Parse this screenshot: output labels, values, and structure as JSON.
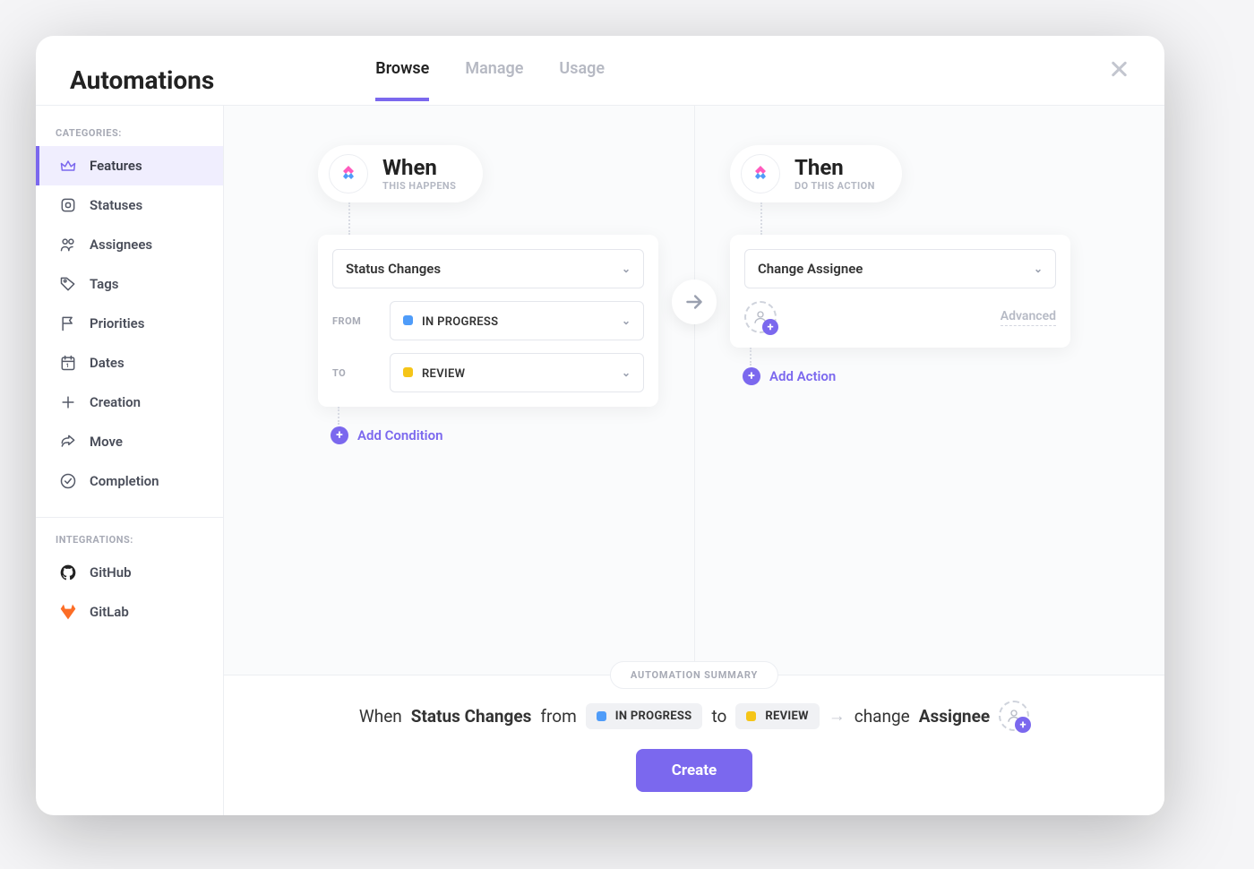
{
  "header": {
    "title": "Automations"
  },
  "tabs": {
    "browse": "Browse",
    "manage": "Manage",
    "usage": "Usage"
  },
  "sidebar": {
    "categories_heading": "CATEGORIES:",
    "integrations_heading": "INTEGRATIONS:",
    "items": {
      "features": "Features",
      "statuses": "Statuses",
      "assignees": "Assignees",
      "tags": "Tags",
      "priorities": "Priorities",
      "dates": "Dates",
      "creation": "Creation",
      "move": "Move",
      "completion": "Completion",
      "github": "GitHub",
      "gitlab": "GitLab"
    }
  },
  "when": {
    "title": "When",
    "subtitle": "THIS HAPPENS",
    "trigger": "Status Changes",
    "from_label": "FROM",
    "to_label": "TO",
    "from_value": "IN PROGRESS",
    "to_value": "REVIEW",
    "add_condition": "Add Condition"
  },
  "then": {
    "title": "Then",
    "subtitle": "DO THIS ACTION",
    "action": "Change Assignee",
    "advanced": "Advanced",
    "add_action": "Add Action"
  },
  "summary": {
    "badge": "AUTOMATION SUMMARY",
    "when": "When",
    "status_changes": "Status Changes",
    "from": "from",
    "to": "to",
    "change": "change",
    "assignee": "Assignee",
    "in_progress": "IN PROGRESS",
    "review": "REVIEW",
    "create": "Create"
  }
}
